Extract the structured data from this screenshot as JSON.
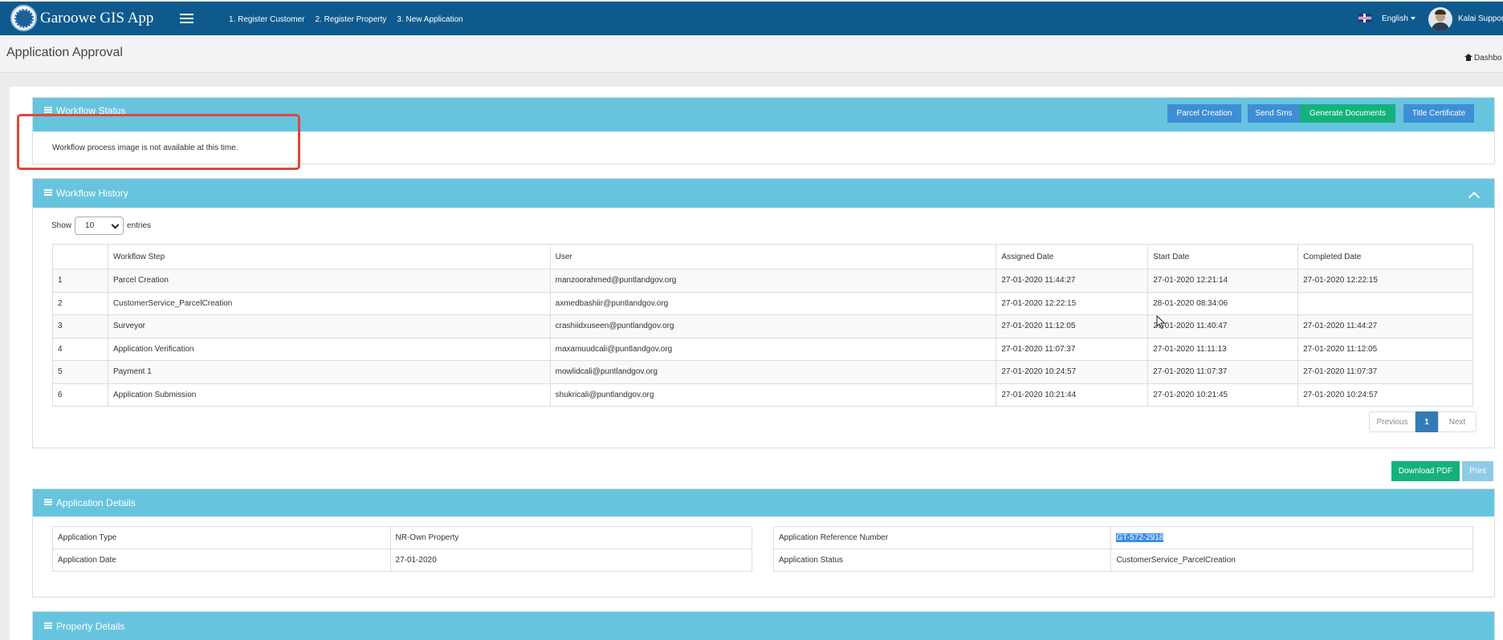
{
  "topbar": {
    "brand": "Garoowe GIS App",
    "nav": [
      "1. Register Customer",
      "2. Register Property",
      "3. New Application"
    ],
    "language": "English",
    "user": "Kalai Suppor"
  },
  "header": {
    "title": "Application Approval",
    "breadcrumb": "Dashbo"
  },
  "workflow_status": {
    "title": "Workflow Status",
    "message": "Workflow process image is not available at this time.",
    "buttons": {
      "parcel_creation": "Parcel Creation",
      "send_sms": "Send Sms",
      "generate_documents": "Generate Documents",
      "title_certificate": "Title Certificate"
    }
  },
  "workflow_history": {
    "title": "Workflow History",
    "show_label": "Show",
    "entries_value": "10",
    "entries_label": "entries",
    "columns": [
      "",
      "Workflow Step",
      "User",
      "Assigned Date",
      "Start Date",
      "Completed Date"
    ],
    "rows": [
      [
        "1",
        "Parcel Creation",
        "manzoorahmed@puntlandgov.org",
        "27-01-2020 11:44:27",
        "27-01-2020 12:21:14",
        "27-01-2020 12:22:15"
      ],
      [
        "2",
        "CustomerService_ParcelCreation",
        "axmedbashiir@puntlandgov.org",
        "27-01-2020 12:22:15",
        "28-01-2020 08:34:06",
        ""
      ],
      [
        "3",
        "Surveyor",
        "crashiidxuseen@puntlandgov.org",
        "27-01-2020 11:12:05",
        "27-01-2020 11:40:47",
        "27-01-2020 11:44:27"
      ],
      [
        "4",
        "Application Verification",
        "maxamuudcali@puntlandgov.org",
        "27-01-2020 11:07:37",
        "27-01-2020 11:11:13",
        "27-01-2020 11:12:05"
      ],
      [
        "5",
        "Payment 1",
        "mowlidcali@puntlandgov.org",
        "27-01-2020 10:24:57",
        "27-01-2020 11:07:37",
        "27-01-2020 11:07:37"
      ],
      [
        "6",
        "Application Submission",
        "shukricali@puntlandgov.org",
        "27-01-2020 10:21:44",
        "27-01-2020 10:21:45",
        "27-01-2020 10:24:57"
      ]
    ],
    "pagination": {
      "previous": "Previous",
      "current": "1",
      "next": "Next"
    }
  },
  "actions": {
    "download_pdf": "Download PDF",
    "print": "Print"
  },
  "application_details": {
    "title": "Application Details",
    "left": [
      {
        "label": "Application Type",
        "value": "NR-Own Property"
      },
      {
        "label": "Application Date",
        "value": "27-01-2020"
      }
    ],
    "right": [
      {
        "label": "Application Reference Number",
        "value": "GT-572-2918"
      },
      {
        "label": "Application Status",
        "value": "CustomerService_ParcelCreation"
      }
    ]
  },
  "property_details": {
    "title": "Property Details"
  },
  "colors": {
    "topbar": "#0e5a8e",
    "panel_header": "#67c4df",
    "button_blue": "#3d8ed6",
    "button_green": "#14b17d",
    "highlight": "#e0463b"
  }
}
